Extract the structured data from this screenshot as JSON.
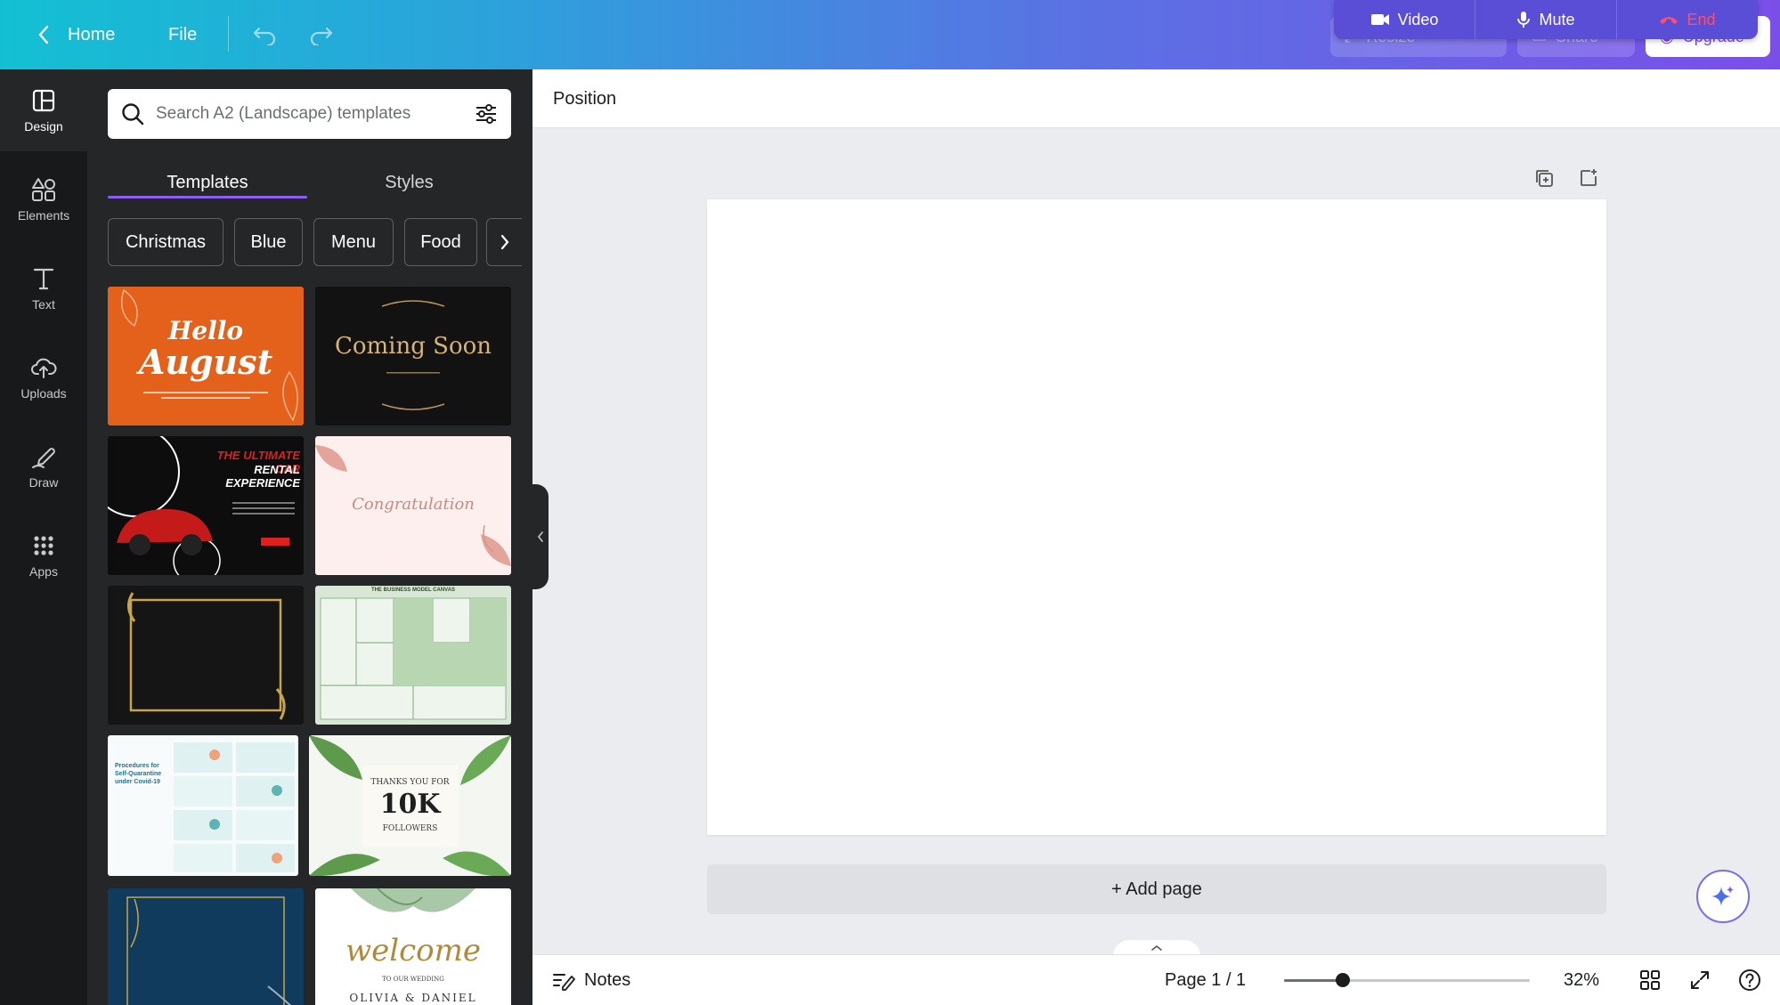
{
  "topbar": {
    "home_label": "Home",
    "file_label": "File",
    "ghost_1": "Resize",
    "ghost_2": "Share",
    "ghost_3": "Upgrade"
  },
  "call_bar": {
    "video_label": "Video",
    "mute_label": "Mute",
    "end_label": "End"
  },
  "rail": {
    "items": [
      {
        "label": "Design",
        "icon": "layout-icon"
      },
      {
        "label": "Elements",
        "icon": "shapes-icon"
      },
      {
        "label": "Text",
        "icon": "text-icon"
      },
      {
        "label": "Uploads",
        "icon": "cloud-upload-icon"
      },
      {
        "label": "Draw",
        "icon": "pen-icon"
      },
      {
        "label": "Apps",
        "icon": "apps-grid-icon"
      }
    ]
  },
  "panel": {
    "search_placeholder": "Search A2 (Landscape) templates",
    "tabs": [
      {
        "label": "Templates"
      },
      {
        "label": "Styles"
      }
    ],
    "chips": [
      {
        "label": "Christmas"
      },
      {
        "label": "Blue"
      },
      {
        "label": "Menu"
      },
      {
        "label": "Food"
      }
    ],
    "thumbs": {
      "t1_line1": "Hello",
      "t1_line2": "August",
      "t2": "Coming Soon",
      "t3_line1": "THE ULTIMATE CAR",
      "t3_line2": "RENTAL EXPERIENCE",
      "t4": "Congratulation",
      "t6": "THE BUSINESS MODEL CANVAS",
      "t7": "Procedures for Self-Quarantine under Covid-19",
      "t8_line1": "THANKS YOU FOR",
      "t8_line2": "10K",
      "t8_line3": "FOLLOWERS",
      "t10_line1": "welcome",
      "t10_line2": "TO OUR WEDDING",
      "t10_line3": "OLIVIA & DANIEL"
    }
  },
  "toolbar2": {
    "position_label": "Position"
  },
  "canvas": {
    "add_page_label": "+ Add page"
  },
  "bottombar": {
    "notes_label": "Notes",
    "page_label": "Page 1 / 1",
    "zoom_label": "32%",
    "zoom_fraction": 0.24
  },
  "colors": {
    "accent": "#8b5cf6",
    "end_call": "#ff4d6a",
    "panel_bg": "#252627",
    "rail_bg": "#18191b"
  }
}
